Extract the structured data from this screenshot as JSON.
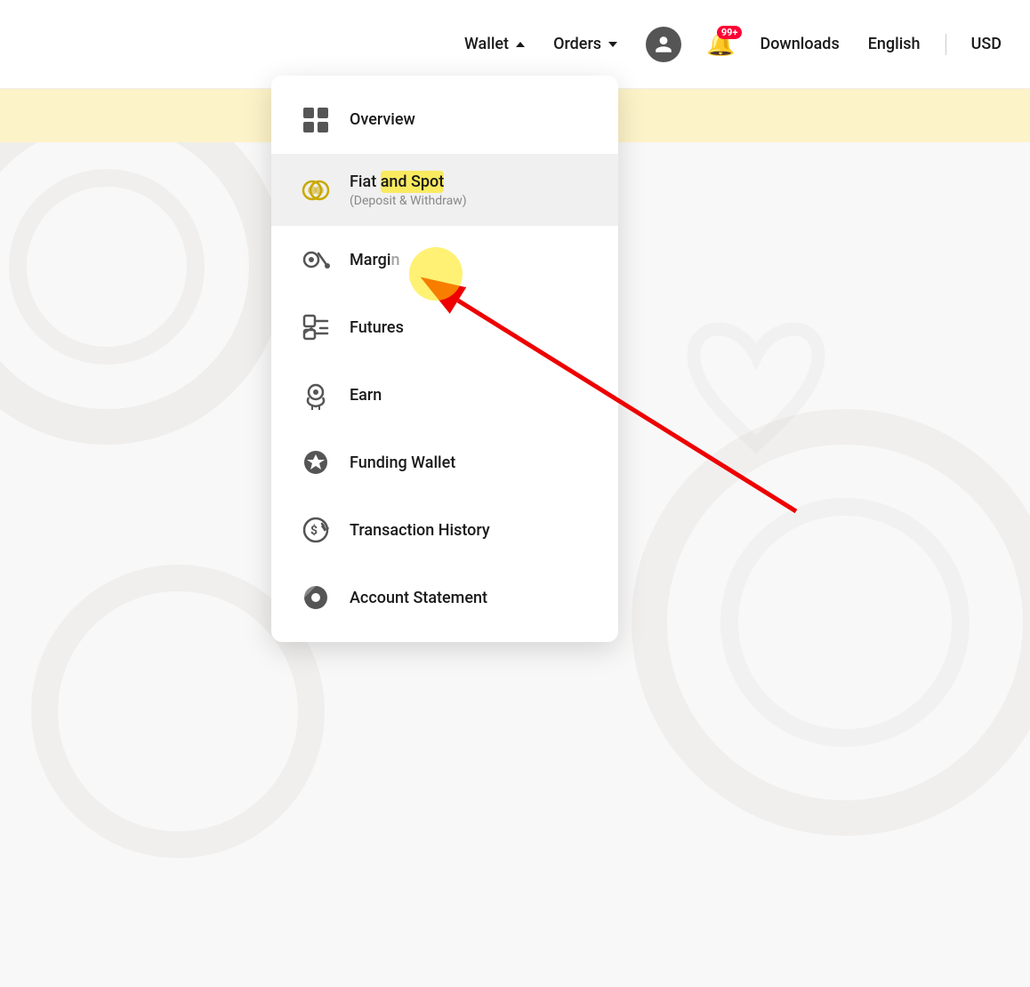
{
  "navbar": {
    "wallet_label": "Wallet",
    "orders_label": "Orders",
    "downloads_label": "Downloads",
    "english_label": "English",
    "usd_label": "USD",
    "notification_badge": "99+"
  },
  "dropdown": {
    "items": [
      {
        "id": "overview",
        "title": "Overview",
        "subtitle": "",
        "icon": "overview"
      },
      {
        "id": "fiat-and-spot",
        "title": "Fiat and Spot",
        "subtitle": "(Deposit & Withdraw)",
        "icon": "fiat-spot",
        "highlighted": true
      },
      {
        "id": "margin",
        "title": "Margin",
        "subtitle": "",
        "icon": "margin"
      },
      {
        "id": "futures",
        "title": "Futures",
        "subtitle": "",
        "icon": "futures"
      },
      {
        "id": "earn",
        "title": "Earn",
        "subtitle": "",
        "icon": "earn"
      },
      {
        "id": "funding-wallet",
        "title": "Funding Wallet",
        "subtitle": "",
        "icon": "funding"
      },
      {
        "id": "transaction-history",
        "title": "Transaction History",
        "subtitle": "",
        "icon": "transaction"
      },
      {
        "id": "account-statement",
        "title": "Account Statement",
        "subtitle": "",
        "icon": "account-statement"
      }
    ]
  }
}
